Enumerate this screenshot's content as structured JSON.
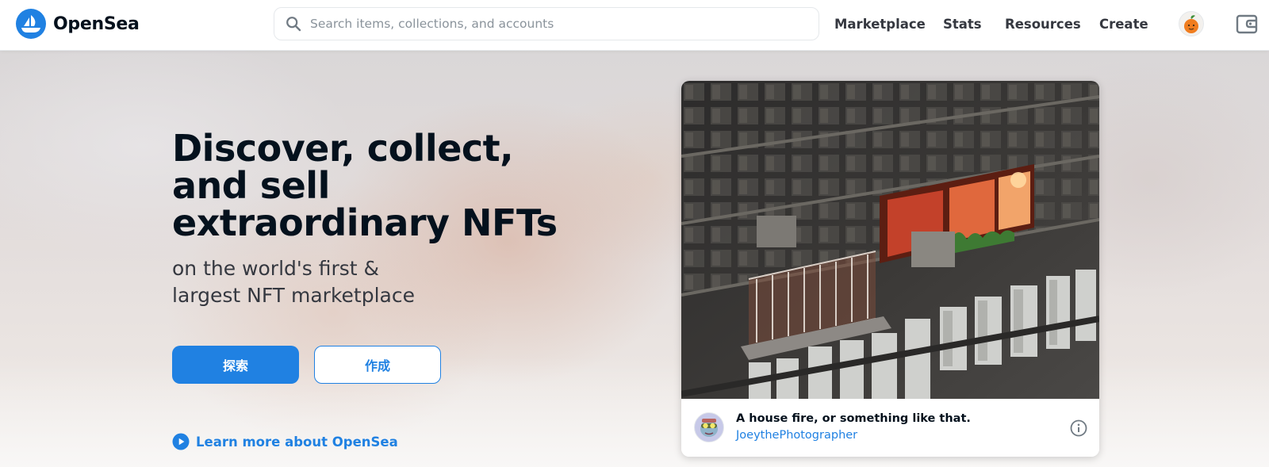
{
  "brand": {
    "name": "OpenSea",
    "accent": "#2081e2"
  },
  "search": {
    "placeholder": "Search items, collections, and accounts"
  },
  "nav": {
    "marketplace": "Marketplace",
    "stats": "Stats",
    "resources": "Resources",
    "create": "Create"
  },
  "icons": {
    "logo": "opensea-boat-logo",
    "search": "search-icon",
    "account": "account-avatar",
    "wallet": "wallet-icon",
    "learn": "play-circle-icon",
    "info": "info-icon"
  },
  "hero": {
    "title": "Discover, collect, and sell extraordinary NFTs",
    "subtitle": "on the world's first & largest NFT marketplace",
    "explore_label": "探索",
    "create_label": "作成",
    "learn_more": "Learn more about OpenSea"
  },
  "featured": {
    "title": "A house fire, or something like that.",
    "creator": "JoeythePhotographer"
  }
}
